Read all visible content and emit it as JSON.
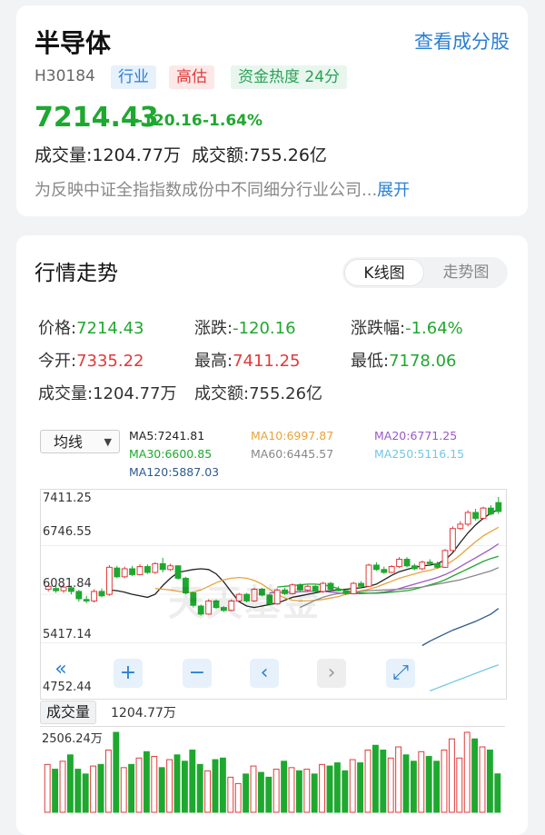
{
  "header": {
    "title": "半导体",
    "link": "查看成分股",
    "code": "H30184",
    "tags": [
      "行业",
      "高估",
      "资金热度 24分"
    ],
    "price": "7214.43",
    "change": "-120.16",
    "change_pct": "-1.64%",
    "volume_line": "成交量:1204.77万  成交额:755.26亿",
    "description": "为反映中证全指指数成份中不同细分行业公司...",
    "expand": "展开"
  },
  "market": {
    "title": "行情走势",
    "tabs": [
      "K线图",
      "走势图"
    ],
    "active_tab": "K线图",
    "stats": [
      {
        "label": "价格:",
        "value": "7214.43",
        "color": "#1fa82f"
      },
      {
        "label": "涨跌:",
        "value": "-120.16",
        "color": "#1fa82f"
      },
      {
        "label": "涨跌幅:",
        "value": "-1.64%",
        "color": "#1fa82f"
      },
      {
        "label": "今开:",
        "value": "7335.22",
        "color": "#e03a3a"
      },
      {
        "label": "最高:",
        "value": "7411.25",
        "color": "#e03a3a"
      },
      {
        "label": "最低:",
        "value": "7178.06",
        "color": "#1fa82f"
      },
      {
        "label": "成交量:",
        "value": "1204.77万",
        "color": "#222222"
      },
      {
        "label": "成交额:",
        "value": "755.26亿",
        "color": "#222222"
      }
    ],
    "ma_select": "均线",
    "ma_legend": [
      {
        "text": "MA5:7241.81",
        "color": "#222222"
      },
      {
        "text": "MA10:6997.87",
        "color": "#e8a33c"
      },
      {
        "text": "MA20:6771.25",
        "color": "#9b59c6"
      },
      {
        "text": "MA30:6600.85",
        "color": "#1fa82f"
      },
      {
        "text": "MA60:6445.57",
        "color": "#888888"
      },
      {
        "text": "MA250:5116.15",
        "color": "#74c7e6"
      },
      {
        "text": "MA120:5887.03",
        "color": "#2c5a8a"
      }
    ],
    "y_ticks": [
      "7411.25",
      "6746.55",
      "6081.84",
      "5417.14",
      "4752.44"
    ],
    "watermark": "天天基金",
    "controls": [
      "«",
      "+",
      "−",
      "‹",
      "›",
      "⤢"
    ],
    "volume_label": "成交量",
    "volume_value": "1204.77万",
    "volume_max": "2506.24万"
  },
  "chart_data": {
    "type": "candlestick",
    "ylim": [
      4752.44,
      7411.25
    ],
    "candles": [
      [
        6150,
        6190,
        6120,
        6210
      ],
      [
        6160,
        6130,
        6100,
        6200
      ],
      [
        6130,
        6180,
        6100,
        6220
      ],
      [
        6170,
        6120,
        6080,
        6200
      ],
      [
        6120,
        6020,
        5980,
        6140
      ],
      [
        6010,
        5990,
        5960,
        6060
      ],
      [
        5990,
        6120,
        5970,
        6150
      ],
      [
        6120,
        6060,
        6040,
        6160
      ],
      [
        6080,
        6450,
        6060,
        6480
      ],
      [
        6440,
        6320,
        6300,
        6470
      ],
      [
        6320,
        6430,
        6300,
        6460
      ],
      [
        6430,
        6350,
        6330,
        6470
      ],
      [
        6350,
        6460,
        6340,
        6490
      ],
      [
        6460,
        6380,
        6360,
        6490
      ],
      [
        6380,
        6500,
        6360,
        6520
      ],
      [
        6500,
        6420,
        6380,
        6580
      ],
      [
        6420,
        6470,
        6400,
        6500
      ],
      [
        6470,
        6300,
        6280,
        6480
      ],
      [
        6300,
        6100,
        6080,
        6320
      ],
      [
        6100,
        5930,
        5900,
        6120
      ],
      [
        5920,
        5810,
        5790,
        5940
      ],
      [
        5810,
        5990,
        5800,
        6010
      ],
      [
        5990,
        5900,
        5880,
        6010
      ],
      [
        5900,
        5860,
        5840,
        5920
      ],
      [
        5860,
        5990,
        5850,
        6010
      ],
      [
        5990,
        6080,
        5980,
        6100
      ],
      [
        6080,
        5990,
        5970,
        6100
      ],
      [
        5990,
        6150,
        5980,
        6170
      ],
      [
        6150,
        6070,
        6050,
        6170
      ],
      [
        6070,
        5950,
        5930,
        6090
      ],
      [
        5950,
        6140,
        5940,
        6160
      ],
      [
        6140,
        6090,
        6070,
        6170
      ],
      [
        6090,
        6210,
        6080,
        6230
      ],
      [
        6210,
        6140,
        6120,
        6230
      ],
      [
        6140,
        6190,
        6120,
        6210
      ],
      [
        6190,
        6120,
        6110,
        6210
      ],
      [
        6120,
        6230,
        6100,
        6250
      ],
      [
        6230,
        6150,
        6130,
        6250
      ],
      [
        6150,
        6130,
        6120,
        6190
      ],
      [
        6130,
        6090,
        6070,
        6150
      ],
      [
        6090,
        6230,
        6080,
        6250
      ],
      [
        6230,
        6190,
        6170,
        6260
      ],
      [
        6190,
        6480,
        6180,
        6500
      ],
      [
        6480,
        6420,
        6400,
        6520
      ],
      [
        6420,
        6380,
        6360,
        6460
      ],
      [
        6380,
        6460,
        6370,
        6480
      ],
      [
        6460,
        6560,
        6440,
        6590
      ],
      [
        6560,
        6470,
        6450,
        6590
      ],
      [
        6470,
        6430,
        6410,
        6500
      ],
      [
        6430,
        6520,
        6410,
        6540
      ],
      [
        6520,
        6500,
        6480,
        6560
      ],
      [
        6500,
        6450,
        6430,
        6530
      ],
      [
        6450,
        6680,
        6440,
        6700
      ],
      [
        6680,
        6980,
        6670,
        7010
      ],
      [
        6980,
        7040,
        6960,
        7080
      ],
      [
        7040,
        7200,
        7010,
        7230
      ],
      [
        7200,
        7120,
        7090,
        7250
      ],
      [
        7120,
        7260,
        7100,
        7280
      ],
      [
        7260,
        7180,
        7160,
        7300
      ],
      [
        7335,
        7214,
        7178,
        7411
      ]
    ],
    "volume": [
      1500,
      1350,
      1600,
      1800,
      1350,
      1200,
      1450,
      1500,
      1950,
      2506,
      1400,
      1500,
      1700,
      1900,
      1750,
      1400,
      1650,
      1800,
      1600,
      1950,
      1500,
      1300,
      1650,
      1700,
      1100,
      900,
      1200,
      1450,
      1250,
      1100,
      1350,
      1600,
      1400,
      1300,
      1350,
      1200,
      1500,
      1450,
      1550,
      1300,
      1650,
      1550,
      1950,
      2100,
      1950,
      1700,
      2050,
      1800,
      1600,
      1900,
      1750,
      1600,
      1950,
      2300,
      1700,
      2506,
      2300,
      2050,
      1950,
      1204
    ],
    "ma": [
      {
        "name": "MA5",
        "color": "#222222",
        "values": [
          6140,
          6130,
          6110,
          6080,
          6060,
          6040,
          6080,
          6200,
          6300,
          6380,
          6400,
          6420,
          6430,
          6420,
          6360,
          6250,
          6110,
          5980,
          5920,
          5900,
          5920,
          5940,
          5960,
          6000,
          6040,
          6060,
          6080,
          6100,
          6120,
          6130,
          6140,
          6150,
          6160,
          6170,
          6190,
          6220,
          6280,
          6340,
          6390,
          6420,
          6450,
          6470,
          6480,
          6500,
          6550,
          6650,
          6790,
          6920,
          7030,
          7120,
          7190,
          7240
        ]
      },
      {
        "name": "MA10",
        "color": "#e8a33c",
        "values": [
          6160,
          6150,
          6140,
          6120,
          6110,
          6110,
          6140,
          6190,
          6240,
          6280,
          6300,
          6310,
          6300,
          6270,
          6220,
          6150,
          6080,
          6030,
          6000,
          5990,
          5990,
          6000,
          6010,
          6030,
          6050,
          6080,
          6100,
          6130,
          6150,
          6180,
          6220,
          6260,
          6300,
          6330,
          6360,
          6390,
          6410,
          6440,
          6480,
          6540,
          6620,
          6710,
          6800,
          6880,
          6940,
          6998
        ]
      },
      {
        "name": "MA20",
        "color": "#9b59c6",
        "values": [
          6100,
          6105,
          6110,
          6110,
          6115,
          6120,
          6125,
          6120,
          6110,
          6100,
          6095,
          6090,
          6090,
          6095,
          6100,
          6110,
          6130,
          6160,
          6190,
          6220,
          6250,
          6280,
          6310,
          6350,
          6400,
          6460,
          6520,
          6580,
          6640,
          6700,
          6771
        ]
      },
      {
        "name": "MA30",
        "color": "#1fa82f",
        "values": [
          6180,
          6190,
          6200,
          6210,
          6220,
          6220,
          6210,
          6190,
          6160,
          6130,
          6110,
          6100,
          6095,
          6095,
          6100,
          6110,
          6120,
          6130,
          6150,
          6180,
          6210,
          6240,
          6280,
          6330,
          6380,
          6430,
          6480,
          6530,
          6570,
          6601
        ]
      },
      {
        "name": "MA60",
        "color": "#888888",
        "values": [
          5900,
          5950,
          6000,
          6040,
          6070,
          6090,
          6100,
          6110,
          6120,
          6130,
          6135,
          6140,
          6145,
          6150,
          6160,
          6170,
          6180,
          6200,
          6220,
          6240,
          6260,
          6280,
          6310,
          6340,
          6370,
          6400,
          6446
        ]
      },
      {
        "name": "MA120",
        "color": "#2c5a8a",
        "values": [
          5380,
          5440,
          5490,
          5540,
          5590,
          5630,
          5670,
          5710,
          5760,
          5810,
          5887
        ]
      },
      {
        "name": "MA250",
        "color": "#74c7e6",
        "values": [
          4760,
          4800,
          4840,
          4880,
          4920,
          4960,
          5000,
          5040,
          5080,
          5116
        ]
      }
    ]
  }
}
